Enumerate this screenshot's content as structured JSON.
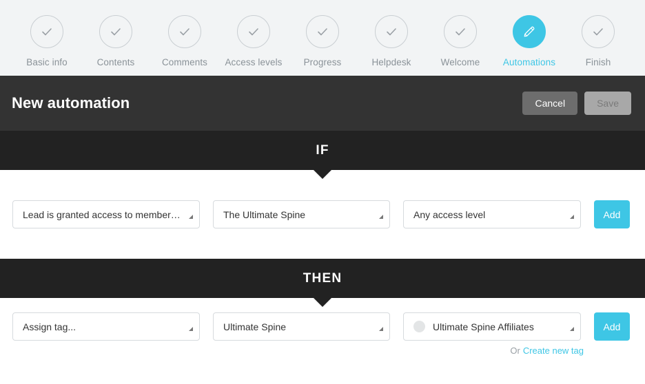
{
  "wizard": {
    "steps": [
      {
        "label": "Basic info",
        "icon": "check-icon",
        "state": "complete"
      },
      {
        "label": "Contents",
        "icon": "check-icon",
        "state": "complete"
      },
      {
        "label": "Comments",
        "icon": "check-icon",
        "state": "complete"
      },
      {
        "label": "Access levels",
        "icon": "check-icon",
        "state": "complete"
      },
      {
        "label": "Progress",
        "icon": "check-icon",
        "state": "complete"
      },
      {
        "label": "Helpdesk",
        "icon": "check-icon",
        "state": "complete"
      },
      {
        "label": "Welcome",
        "icon": "check-icon",
        "state": "complete"
      },
      {
        "label": "Automations",
        "icon": "pencil-icon",
        "state": "active"
      },
      {
        "label": "Finish",
        "icon": "check-icon",
        "state": "complete"
      }
    ]
  },
  "header": {
    "title": "New automation",
    "cancel_label": "Cancel",
    "save_label": "Save"
  },
  "if_section": {
    "band_label": "IF",
    "trigger": {
      "value": "Lead is granted access to membership...",
      "arrow": "chevron-down-icon"
    },
    "target": {
      "value": "The Ultimate Spine",
      "arrow": "chevron-down-icon"
    },
    "access_level": {
      "value": "Any access level",
      "arrow": "chevron-down-icon"
    },
    "add_label": "Add"
  },
  "then_section": {
    "band_label": "THEN",
    "action": {
      "value": "Assign tag...",
      "arrow": "chevron-down-icon"
    },
    "product": {
      "value": "Ultimate Spine",
      "arrow": "chevron-down-icon"
    },
    "tag": {
      "value": "Ultimate Spine Affiliates",
      "swatch_color": "#e3e5e6",
      "arrow": "chevron-down-icon"
    },
    "add_label": "Add",
    "create_tag_prefix": "Or",
    "create_tag_link": "Create new tag"
  },
  "colors": {
    "accent": "#3ec6e5",
    "band_bg": "#222222",
    "header_bg": "#333333",
    "wizard_bg": "#f2f4f5",
    "muted_text": "#8a9298"
  }
}
